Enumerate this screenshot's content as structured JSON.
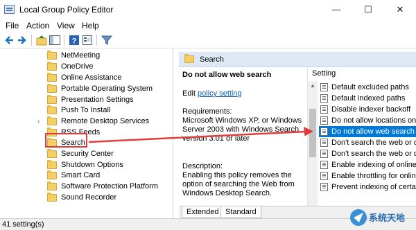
{
  "window": {
    "title": "Local Group Policy Editor",
    "minimize_glyph": "—",
    "maximize_glyph": "☐",
    "close_glyph": "✕"
  },
  "menu": {
    "file": "File",
    "action": "Action",
    "view": "View",
    "help": "Help"
  },
  "toolbar": {
    "icons": [
      "back-arrow-icon",
      "forward-arrow-icon",
      "up-folder-icon",
      "show-hide-tree-icon",
      "help-icon",
      "properties-icon",
      "filter-icon"
    ]
  },
  "tree": {
    "items": [
      {
        "label": "NetMeeting",
        "expandable": false
      },
      {
        "label": "OneDrive",
        "expandable": false
      },
      {
        "label": "Online Assistance",
        "expandable": false
      },
      {
        "label": "Portable Operating System",
        "expandable": false
      },
      {
        "label": "Presentation Settings",
        "expandable": false
      },
      {
        "label": "Push To Install",
        "expandable": false
      },
      {
        "label": "Remote Desktop Services",
        "expandable": true
      },
      {
        "label": "RSS Feeds",
        "expandable": false
      },
      {
        "label": "Search",
        "expandable": false,
        "selected": true
      },
      {
        "label": "Security Center",
        "expandable": false
      },
      {
        "label": "Shutdown Options",
        "expandable": false
      },
      {
        "label": "Smart Card",
        "expandable": false
      },
      {
        "label": "Software Protection Platform",
        "expandable": false
      },
      {
        "label": "Sound Recorder",
        "expandable": false
      }
    ]
  },
  "detail": {
    "folder_title": "Search",
    "policy_title": "Do not allow web search",
    "edit_prefix": "Edit ",
    "edit_link": "policy setting",
    "requirements_label": "Requirements:",
    "requirements_text": "Microsoft Windows XP, or Windows Server 2003 with Windows Search version 3.01 or later",
    "description_label": "Description:",
    "description_text": "Enabling this policy removes the option of searching the Web from Windows Desktop Search."
  },
  "list": {
    "column_header": "Setting",
    "rows": [
      "Default excluded paths",
      "Default indexed paths",
      "Disable indexer backoff",
      "Do not allow locations on",
      "Do not allow web search",
      "Don't search the web or di",
      "Don't search the web or di",
      "Enable indexing of online c",
      "Enable throttling for online",
      "Prevent indexing of certair"
    ],
    "selected_index": 4
  },
  "tabs": {
    "extended": "Extended",
    "standard": "Standard"
  },
  "status": {
    "text": "41 setting(s)"
  },
  "watermark": {
    "text": "系统天地"
  },
  "colors": {
    "selection_blue": "#0078d7",
    "header_blue": "#dfe9f5",
    "annotation_red": "#e23b3b",
    "folder_yellow": "#f4cf66",
    "link_blue": "#0b5bb5"
  }
}
